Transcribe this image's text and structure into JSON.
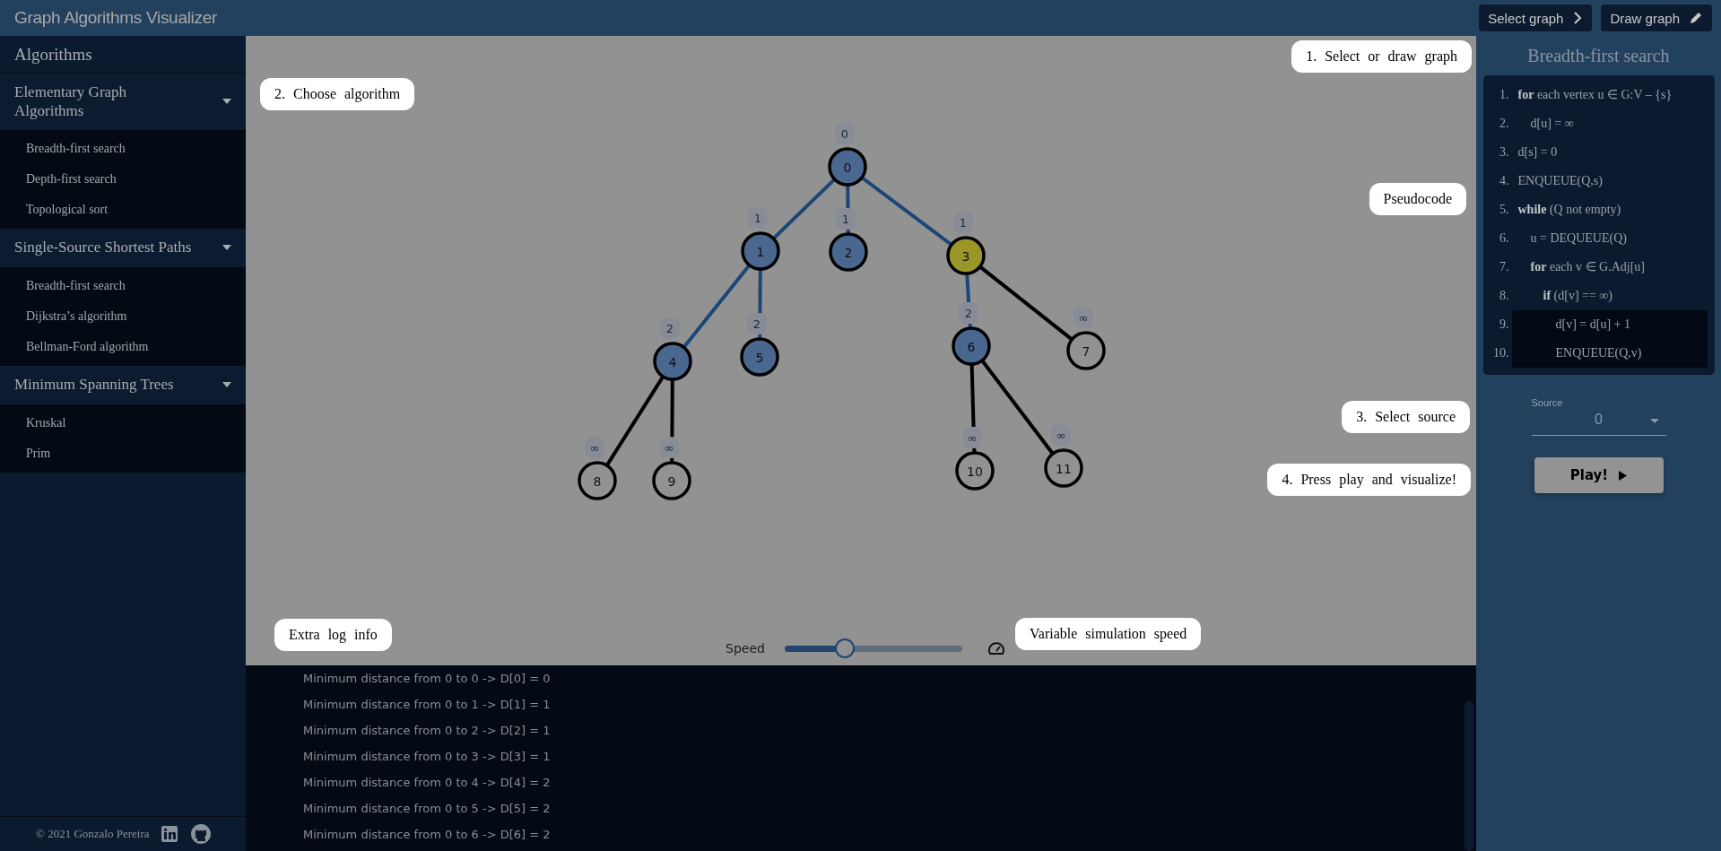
{
  "header": {
    "title": "Graph Algorithms Visualizer",
    "buttons": [
      {
        "label": "Select graph"
      },
      {
        "label": "Draw graph"
      }
    ]
  },
  "sidebar": {
    "title": "Algorithms",
    "sections": [
      {
        "title": "Elementary Graph Algorithms",
        "expanded": true,
        "items": [
          "Breadth-first search",
          "Depth-first search",
          "Topological sort"
        ]
      },
      {
        "title": "Single-Source Shortest Paths",
        "expanded": true,
        "items": [
          "Breadth-first search",
          "Dijkstra’s algorithm",
          "Bellman-Ford algorithm"
        ]
      },
      {
        "title": "Minimum Spanning Trees",
        "expanded": true,
        "items": [
          "Kruskal",
          "Prim"
        ]
      }
    ],
    "footer": "© 2021 Gonzalo Pereira"
  },
  "canvas": {
    "graph": {
      "label": "0",
      "distance": "0",
      "visited": true,
      "current": false,
      "children": [
        {
          "label": "1",
          "distance": "1",
          "visited": true,
          "current": false,
          "children": [
            {
              "label": "4",
              "distance": "2",
              "visited": true,
              "current": false,
              "children": [
                {
                  "label": "8",
                  "distance": "∞",
                  "visited": false,
                  "current": false
                },
                {
                  "label": "9",
                  "distance": "∞",
                  "visited": false,
                  "current": false
                }
              ]
            },
            {
              "label": "5",
              "distance": "2",
              "visited": true,
              "current": false
            }
          ]
        },
        {
          "label": "2",
          "distance": "1",
          "visited": true,
          "current": false
        },
        {
          "label": "3",
          "distance": "1",
          "visited": true,
          "current": true,
          "children": [
            {
              "label": "6",
              "distance": "2",
              "visited": true,
              "current": false,
              "children": [
                {
                  "label": "10",
                  "distance": "∞",
                  "visited": false,
                  "current": false
                },
                {
                  "label": "11",
                  "distance": "∞",
                  "visited": false,
                  "current": false
                }
              ]
            },
            {
              "label": "7",
              "distance": "∞",
              "visited": false,
              "current": false
            }
          ]
        }
      ]
    },
    "edges": [
      {
        "tree": true
      },
      {
        "tree": true
      },
      {
        "tree": false
      },
      {
        "tree": false
      },
      {
        "tree": true
      },
      {
        "tree": true
      },
      {
        "tree": true
      },
      {
        "tree": true
      },
      {
        "tree": false
      },
      {
        "tree": false
      },
      {
        "tree": false
      }
    ],
    "tips": [
      "1. Select or draw graph",
      "2. Choose algorithm",
      "Pseudocode",
      "3. Select source",
      "4. Press play and visualize!",
      "Extra log info",
      "Variable simulation speed"
    ],
    "speed": {
      "label": "Speed",
      "level": 0.31
    }
  },
  "log": [
    "Minimum distance from 0 to 0 -> D[0] = 0",
    "Minimum distance from 0 to 1 -> D[1] = 1",
    "Minimum distance from 0 to 2 -> D[2] = 1",
    "Minimum distance from 0 to 3 -> D[3] = 1",
    "Minimum distance from 0 to 4 -> D[4] = 2",
    "Minimum distance from 0 to 5 -> D[5] = 2",
    "Minimum distance from 0 to 6 -> D[6] = 2"
  ],
  "panel": {
    "title": "Breadth-first search",
    "pseudocode": [
      {
        "number": "1.",
        "code": "**for** each vertex u ∈ G:V – {s}",
        "highlighted": false,
        "children": [
          {
            "number": "2.",
            "code": "d[u] = ∞",
            "highlighted": false
          }
        ]
      },
      {
        "number": "3.",
        "code": "d[s] = 0",
        "highlighted": false
      },
      {
        "number": "4.",
        "code": "ENQUEUE(Q,s)",
        "highlighted": false
      },
      {
        "number": "5.",
        "code": "**while** (Q not empty)",
        "highlighted": false,
        "children": [
          {
            "number": "6.",
            "code": "u = DEQUEUE(Q)",
            "highlighted": false
          },
          {
            "number": "7.",
            "code": "**for** each v ∈ G.Adj[u]",
            "highlighted": false,
            "children": [
              {
                "number": "8.",
                "code": "**if** (d[v] == ∞)",
                "highlighted": false,
                "children": [
                  {
                    "number": "9.",
                    "code": "d[v] = d[u] + 1",
                    "highlighted": true
                  },
                  {
                    "number": "10.",
                    "code": "ENQUEUE(Q,v)",
                    "highlighted": true
                  }
                ]
              }
            ]
          }
        ]
      }
    ],
    "source": {
      "label": "Source",
      "value": "0"
    },
    "play_button": "Play!"
  }
}
